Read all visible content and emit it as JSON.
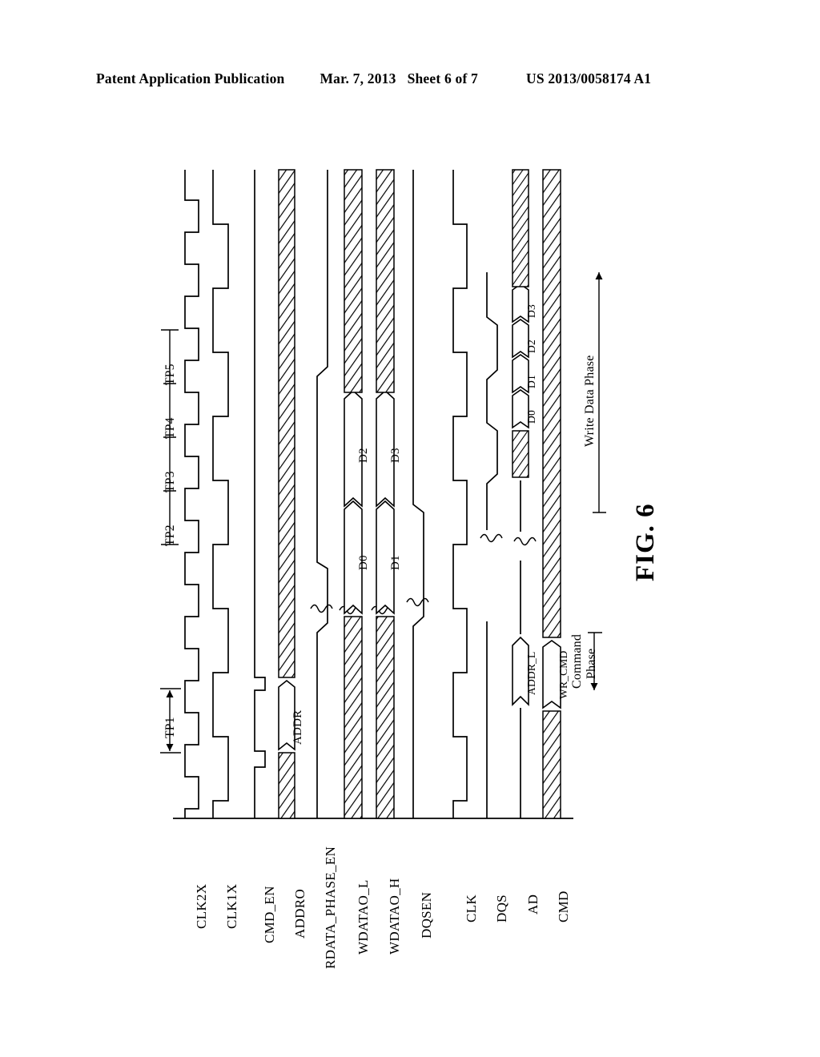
{
  "header": {
    "publication": "Patent Application Publication",
    "date": "Mar. 7, 2013",
    "sheet": "Sheet 6 of 7",
    "number": "US 2013/0058174 A1"
  },
  "figure": {
    "caption": "FIG. 6",
    "signals": [
      {
        "id": "clk2x",
        "label": "CLK2X"
      },
      {
        "id": "clk1x",
        "label": "CLK1X"
      },
      {
        "id": "cmd_en",
        "label": "CMD_EN"
      },
      {
        "id": "addro",
        "label": "ADDRO"
      },
      {
        "id": "rdata_phase_en",
        "label": "RDATA_PHASE_EN"
      },
      {
        "id": "wdatao_l",
        "label": "WDATAO_L"
      },
      {
        "id": "wdatao_h",
        "label": "WDATAO_H"
      },
      {
        "id": "dqsen",
        "label": "DQSEN"
      },
      {
        "id": "clk",
        "label": "CLK"
      },
      {
        "id": "dqs",
        "label": "DQS"
      },
      {
        "id": "ad",
        "label": "AD"
      },
      {
        "id": "cmd",
        "label": "CMD"
      }
    ],
    "time_points": [
      "TP1",
      "TP2",
      "TP3",
      "TP4",
      "TP5"
    ],
    "bus_values": {
      "addro": [
        "ADDR"
      ],
      "wdatao_l": [
        "D0",
        "D2"
      ],
      "wdatao_h": [
        "D1",
        "D3"
      ],
      "ad": [
        "ADDR_L",
        "D0",
        "D1",
        "D2",
        "D3"
      ],
      "cmd": [
        "WR_CMD"
      ]
    },
    "phases": [
      {
        "id": "command-phase",
        "label": "Command\nPhase",
        "line1": "Command",
        "line2": "Phase"
      },
      {
        "id": "write-data-phase",
        "label": "Write Data Phase"
      }
    ]
  }
}
